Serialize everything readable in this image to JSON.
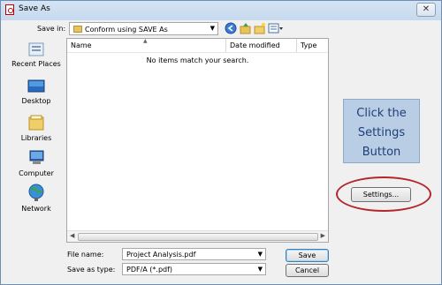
{
  "window": {
    "title": "Save As"
  },
  "toolbar": {
    "save_in_label": "Save in:",
    "location": "Conform using SAVE As",
    "icons": [
      "back-icon",
      "up-folder-icon",
      "new-folder-icon",
      "view-menu-icon"
    ]
  },
  "places": [
    {
      "label": "Recent Places",
      "icon": "recent-places-icon"
    },
    {
      "label": "Desktop",
      "icon": "desktop-icon"
    },
    {
      "label": "Libraries",
      "icon": "libraries-icon"
    },
    {
      "label": "Computer",
      "icon": "computer-icon"
    },
    {
      "label": "Network",
      "icon": "network-icon"
    }
  ],
  "file_list": {
    "columns": [
      "Name",
      "Date modified",
      "Type"
    ],
    "empty_message": "No items match your search."
  },
  "form": {
    "file_name_label": "File name:",
    "file_name_value": "Project Analysis.pdf",
    "save_as_type_label": "Save as type:",
    "save_as_type_value": "PDF/A (*.pdf)"
  },
  "buttons": {
    "save": "Save",
    "cancel": "Cancel",
    "settings": "Settings..."
  },
  "callout": {
    "text": "Click the Settings Button"
  },
  "colors": {
    "callout_bg": "#b9cde5",
    "callout_text": "#1f3f7a",
    "ring": "#b3262c"
  }
}
